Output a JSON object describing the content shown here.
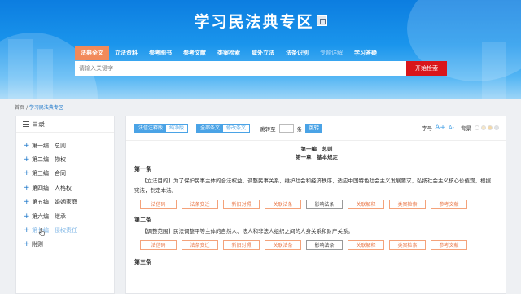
{
  "header": {
    "title": "学习民法典专区",
    "nav": [
      {
        "label": "法典全文",
        "active": true
      },
      {
        "label": "立法资料"
      },
      {
        "label": "参考图书"
      },
      {
        "label": "参考文献"
      },
      {
        "label": "类案检索"
      },
      {
        "label": "域外立法"
      },
      {
        "label": "法条识别"
      },
      {
        "label": "专题详解",
        "dim": true
      },
      {
        "label": "学习答疑"
      }
    ],
    "search": {
      "placeholder": "请输入关键字",
      "button": "开始检索"
    }
  },
  "breadcrumb": {
    "home": "首页",
    "sep": "/",
    "current": "学习民法典专区"
  },
  "sidebar": {
    "title": "目录",
    "items": [
      {
        "code": "第一编",
        "name": "总则"
      },
      {
        "code": "第二编",
        "name": "物权"
      },
      {
        "code": "第三编",
        "name": "合同"
      },
      {
        "code": "第四编",
        "name": "人格权"
      },
      {
        "code": "第五编",
        "name": "婚姻家庭"
      },
      {
        "code": "第六编",
        "name": "继承"
      },
      {
        "code": "第七编",
        "name": "侵权责任"
      },
      {
        "code": "附则",
        "name": ""
      }
    ]
  },
  "toolbar": {
    "mode": [
      "法信注释版",
      "纯净版"
    ],
    "scope": [
      "全部条文",
      "修改条文"
    ],
    "jump_prefix": "跳转至",
    "jump_suffix": "条",
    "jump_button": "跳转",
    "font_label": "字号",
    "font_plus": "A+",
    "font_minus": "A-",
    "bg_label": "背景",
    "bg_colors": [
      "#ffffff",
      "#f6e7c8",
      "#f4d9a8",
      "#dfe3e8"
    ]
  },
  "document": {
    "part": "第一编　总则",
    "chapter": "第一章　基本规定",
    "articles": [
      {
        "title": "第一条",
        "text": "【立法目的】为了保护民事主体的合法权益，调整民事关系，维护社会和经济秩序，适应中国特色社会主义发展要求，弘扬社会主义核心价值观，根据宪法，制定本法。"
      },
      {
        "title": "第二条",
        "text": "【调整范围】民法调整平等主体的自然人、法人和非法人组织之间的人身关系和财产关系。"
      },
      {
        "title": "第三条",
        "text": ""
      }
    ],
    "actions": [
      "法信码",
      "法条变迁",
      "新旧对照",
      "关联法条",
      "影响法条",
      "关联解释",
      "类案检索",
      "参考文献"
    ],
    "selected_action": "影响法条"
  }
}
